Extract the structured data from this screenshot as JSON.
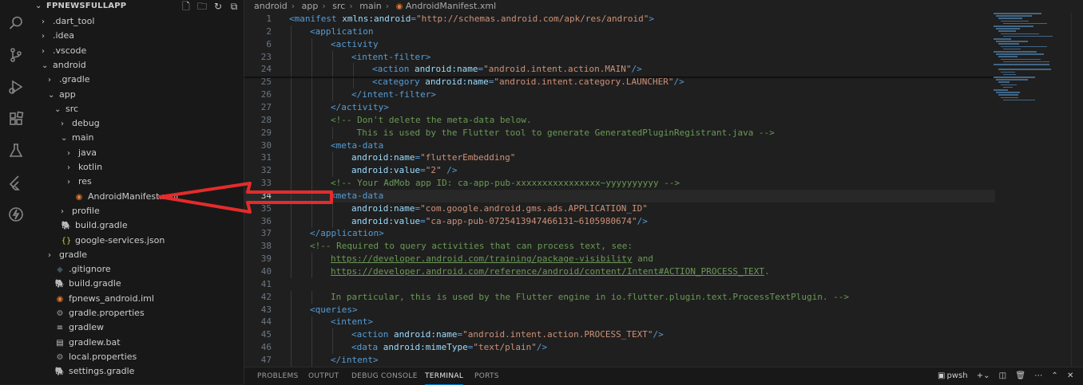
{
  "explorer": {
    "title": "FPNEWSFULLAPP",
    "items": [
      {
        "label": ".dart_tool",
        "type": "folder",
        "open": false,
        "depth": 1
      },
      {
        "label": ".idea",
        "type": "folder",
        "open": false,
        "depth": 1
      },
      {
        "label": ".vscode",
        "type": "folder",
        "open": false,
        "depth": 1
      },
      {
        "label": "android",
        "type": "folder",
        "open": true,
        "depth": 1
      },
      {
        "label": ".gradle",
        "type": "folder",
        "open": false,
        "depth": 2
      },
      {
        "label": "app",
        "type": "folder",
        "open": true,
        "depth": 2
      },
      {
        "label": "src",
        "type": "folder",
        "open": true,
        "depth": 3
      },
      {
        "label": "debug",
        "type": "folder",
        "open": false,
        "depth": 4
      },
      {
        "label": "main",
        "type": "folder",
        "open": true,
        "depth": 4
      },
      {
        "label": "java",
        "type": "folder",
        "open": false,
        "depth": 5
      },
      {
        "label": "kotlin",
        "type": "folder",
        "open": false,
        "depth": 5
      },
      {
        "label": "res",
        "type": "folder",
        "open": false,
        "depth": 5
      },
      {
        "label": "AndroidManifest.xml",
        "type": "xml",
        "depth": 5
      },
      {
        "label": "profile",
        "type": "folder",
        "open": false,
        "depth": 4
      },
      {
        "label": "build.gradle",
        "type": "gradle",
        "depth": 3
      },
      {
        "label": "google-services.json",
        "type": "json",
        "depth": 3
      },
      {
        "label": "gradle",
        "type": "folder",
        "open": false,
        "depth": 2
      },
      {
        "label": ".gitignore",
        "type": "git",
        "depth": 2
      },
      {
        "label": "build.gradle",
        "type": "gradle",
        "depth": 2
      },
      {
        "label": "fpnews_android.iml",
        "type": "xml",
        "depth": 2
      },
      {
        "label": "gradle.properties",
        "type": "gear",
        "depth": 2
      },
      {
        "label": "gradlew",
        "type": "file",
        "depth": 2
      },
      {
        "label": "gradlew.bat",
        "type": "bat",
        "depth": 2
      },
      {
        "label": "local.properties",
        "type": "gear",
        "depth": 2
      },
      {
        "label": "settings.gradle",
        "type": "gradle",
        "depth": 2
      }
    ]
  },
  "breadcrumb": [
    "android",
    "app",
    "src",
    "main",
    "AndroidManifest.xml"
  ],
  "editor": {
    "active_line": "34",
    "lines": [
      {
        "n": "1",
        "indent": 0,
        "parts": [
          [
            "tag",
            "<manifest "
          ],
          [
            "attr",
            "xmlns:android"
          ],
          [
            "tag",
            "="
          ],
          [
            "val",
            "\"http://schemas.android.com/apk/res/android\""
          ],
          [
            "tag",
            ">"
          ]
        ]
      },
      {
        "n": "2",
        "indent": 1,
        "parts": [
          [
            "tag",
            "<application"
          ]
        ]
      },
      {
        "n": "6",
        "indent": 2,
        "parts": [
          [
            "tag",
            "<activity"
          ]
        ]
      },
      {
        "n": "23",
        "indent": 3,
        "parts": [
          [
            "tag",
            "<intent-filter>"
          ]
        ]
      },
      {
        "n": "24",
        "indent": 4,
        "parts": [
          [
            "tag",
            "<action "
          ],
          [
            "attr",
            "android:name"
          ],
          [
            "tag",
            "="
          ],
          [
            "val",
            "\"android.intent.action.MAIN\""
          ],
          [
            "tag",
            "/>"
          ]
        ]
      },
      {
        "n": "25",
        "indent": 4,
        "parts": [
          [
            "tag",
            "<category "
          ],
          [
            "attr",
            "android:name"
          ],
          [
            "tag",
            "="
          ],
          [
            "val",
            "\"android.intent.category.LAUNCHER\""
          ],
          [
            "tag",
            "/>"
          ]
        ]
      },
      {
        "n": "26",
        "indent": 3,
        "parts": [
          [
            "tag",
            "</intent-filter>"
          ]
        ]
      },
      {
        "n": "27",
        "indent": 2,
        "parts": [
          [
            "tag",
            "</activity>"
          ]
        ]
      },
      {
        "n": "28",
        "indent": 2,
        "parts": [
          [
            "cmt",
            "<!-- Don't delete the meta-data below."
          ]
        ]
      },
      {
        "n": "29",
        "indent": 3,
        "parts": [
          [
            "cmt",
            " This is used by the Flutter tool to generate GeneratedPluginRegistrant.java -->"
          ]
        ]
      },
      {
        "n": "30",
        "indent": 2,
        "parts": [
          [
            "tag",
            "<meta-data"
          ]
        ]
      },
      {
        "n": "31",
        "indent": 3,
        "parts": [
          [
            "attr",
            "android:name"
          ],
          [
            "tag",
            "="
          ],
          [
            "val",
            "\"flutterEmbedding\""
          ]
        ]
      },
      {
        "n": "32",
        "indent": 3,
        "parts": [
          [
            "attr",
            "android:value"
          ],
          [
            "tag",
            "="
          ],
          [
            "val",
            "\"2\""
          ],
          [
            "tag",
            " />"
          ]
        ]
      },
      {
        "n": "33",
        "indent": 2,
        "parts": [
          [
            "cmt",
            "<!-- Your AdMob app ID: ca-app-pub-xxxxxxxxxxxxxxxx~yyyyyyyyyy -->"
          ]
        ]
      },
      {
        "n": "34",
        "indent": 2,
        "parts": [
          [
            "tag",
            "<meta-data"
          ]
        ]
      },
      {
        "n": "35",
        "indent": 3,
        "parts": [
          [
            "attr",
            "android:name"
          ],
          [
            "tag",
            "="
          ],
          [
            "val",
            "\"com.google.android.gms.ads.APPLICATION_ID\""
          ]
        ]
      },
      {
        "n": "36",
        "indent": 3,
        "parts": [
          [
            "attr",
            "android:value"
          ],
          [
            "tag",
            "="
          ],
          [
            "val",
            "\"ca-app-pub-0725413947466131~6105980674\""
          ],
          [
            "tag",
            "/>"
          ]
        ]
      },
      {
        "n": "37",
        "indent": 1,
        "parts": [
          [
            "tag",
            "</application>"
          ]
        ]
      },
      {
        "n": "38",
        "indent": 1,
        "parts": [
          [
            "cmt",
            "<!-- Required to query activities that can process text, see:"
          ]
        ]
      },
      {
        "n": "39",
        "indent": 2,
        "parts": [
          [
            "lnk",
            "https://developer.android.com/training/package-visibility"
          ],
          [
            "cmt",
            " and"
          ]
        ]
      },
      {
        "n": "40",
        "indent": 2,
        "parts": [
          [
            "lnk",
            "https://developer.android.com/reference/android/content/Intent#ACTION_PROCESS_TEXT"
          ],
          [
            "cmt",
            "."
          ]
        ]
      },
      {
        "n": "41",
        "indent": 0,
        "parts": []
      },
      {
        "n": "42",
        "indent": 2,
        "parts": [
          [
            "cmt",
            "In particular, this is used by the Flutter engine in io.flutter.plugin.text.ProcessTextPlugin. -->"
          ]
        ]
      },
      {
        "n": "43",
        "indent": 1,
        "parts": [
          [
            "tag",
            "<queries>"
          ]
        ]
      },
      {
        "n": "44",
        "indent": 2,
        "parts": [
          [
            "tag",
            "<intent>"
          ]
        ]
      },
      {
        "n": "45",
        "indent": 3,
        "parts": [
          [
            "tag",
            "<action "
          ],
          [
            "attr",
            "android:name"
          ],
          [
            "tag",
            "="
          ],
          [
            "val",
            "\"android.intent.action.PROCESS_TEXT\""
          ],
          [
            "tag",
            "/>"
          ]
        ]
      },
      {
        "n": "46",
        "indent": 3,
        "parts": [
          [
            "tag",
            "<data "
          ],
          [
            "attr",
            "android:mimeType"
          ],
          [
            "tag",
            "="
          ],
          [
            "val",
            "\"text/plain\""
          ],
          [
            "tag",
            "/>"
          ]
        ]
      },
      {
        "n": "47",
        "indent": 2,
        "parts": [
          [
            "tag",
            "</intent>"
          ]
        ]
      }
    ]
  },
  "panel": {
    "tabs": [
      "PROBLEMS",
      "OUTPUT",
      "DEBUG CONSOLE",
      "TERMINAL",
      "PORTS"
    ],
    "active_tab": "TERMINAL",
    "terminal_name": "pwsh"
  },
  "colors": {
    "annotation_arrow": "#e52b2b",
    "accent": "#0078d4"
  }
}
